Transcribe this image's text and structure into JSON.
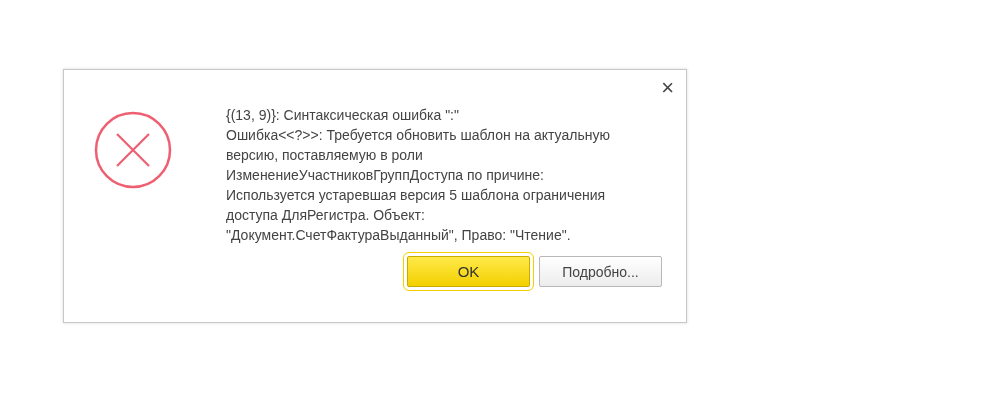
{
  "dialog": {
    "close": "×",
    "message_lines": [
      "{(13, 9)}: Синтаксическая ошибка \":\"",
      "Ошибка<<?>>: Требуется обновить шаблон на актуальную",
      "версию, поставляемую в роли",
      "ИзменениеУчастниковГруппДоступа по причине:",
      "Используется устаревшая версия 5 шаблона ограничения",
      "доступа ДляРегистра. Объект:",
      "\"Документ.СчетФактураВыданный\", Право: \"Чтение\"."
    ],
    "buttons": [
      {
        "label": "OK",
        "kind": "default"
      },
      {
        "label": "Подробно...",
        "kind": "normal"
      }
    ]
  }
}
